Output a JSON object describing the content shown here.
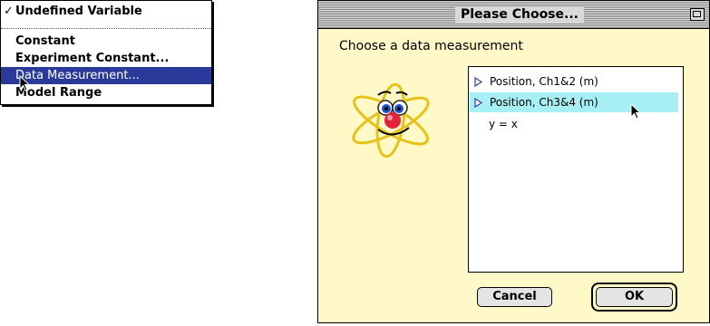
{
  "menu": {
    "items": [
      {
        "label": "Undefined Variable",
        "checked": true
      },
      {
        "label": "Constant"
      },
      {
        "label": "Experiment Constant..."
      },
      {
        "label": "Data Measurement...",
        "highlighted": true
      },
      {
        "label": "Model Range"
      }
    ],
    "check_glyph": "✓",
    "highlight_color": "#2a3a9a"
  },
  "dialog": {
    "title": "Please Choose...",
    "prompt": "Choose a data measurement",
    "list": [
      {
        "label": "Position, Ch1&2 (m)",
        "icon": "disclosure-triangle-icon"
      },
      {
        "label": "Position, Ch3&4 (m)",
        "icon": "disclosure-triangle-icon",
        "selected": true
      },
      {
        "label": "y = x"
      }
    ],
    "buttons": {
      "cancel": "Cancel",
      "ok": "OK"
    },
    "background_color": "#fff9c8",
    "selection_color": "#a6f0f5"
  }
}
